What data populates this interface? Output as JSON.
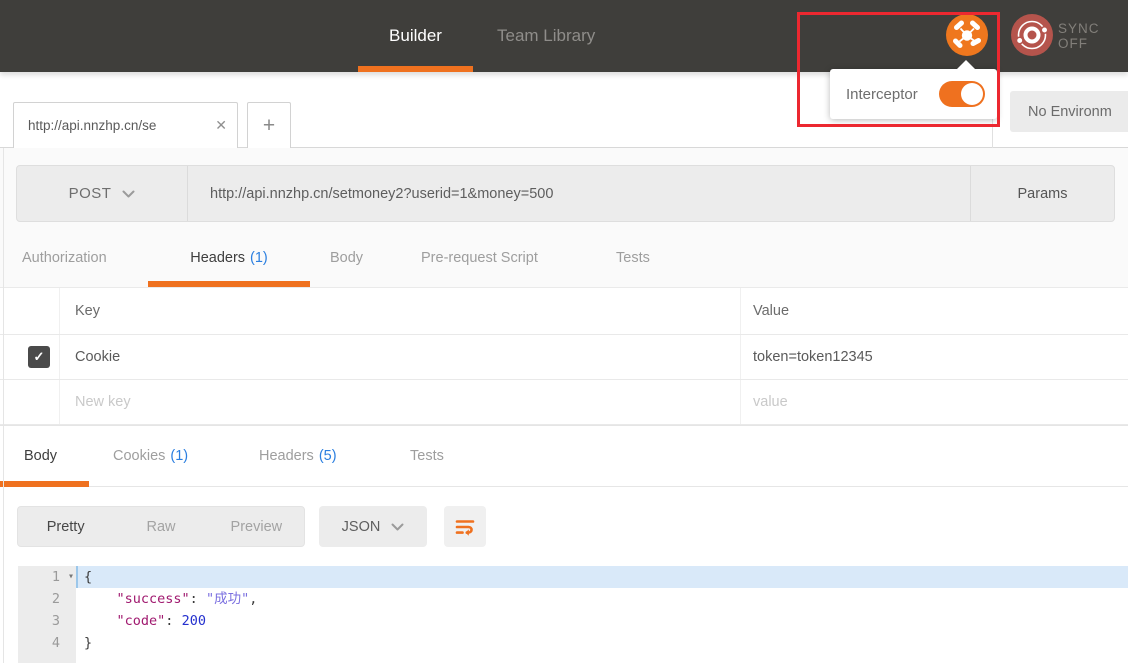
{
  "header": {
    "builder_label": "Builder",
    "team_library_label": "Team Library",
    "sync_status": "SYNC OFF"
  },
  "interceptor_popover": {
    "label": "Interceptor",
    "toggle_state": "on"
  },
  "environment": {
    "selector_label": "No Environm"
  },
  "tabs": {
    "open_tab_title": "http://api.nnzhp.cn/se"
  },
  "request": {
    "method": "POST",
    "url": "http://api.nnzhp.cn/setmoney2?userid=1&money=500",
    "params_label": "Params",
    "tabs": {
      "authorization": {
        "label": "Authorization"
      },
      "headers": {
        "label": "Headers",
        "count": "(1)"
      },
      "body": {
        "label": "Body"
      },
      "pre_request_script": {
        "label": "Pre-request Script"
      },
      "tests": {
        "label": "Tests"
      }
    },
    "headers_table": {
      "key_header": "Key",
      "value_header": "Value",
      "rows": [
        {
          "checked": true,
          "key": "Cookie",
          "value": "token=token12345"
        }
      ],
      "new_row": {
        "key_placeholder": "New key",
        "value_placeholder": "value"
      }
    }
  },
  "response": {
    "tabs": {
      "body": {
        "label": "Body"
      },
      "cookies": {
        "label": "Cookies",
        "count": "(1)"
      },
      "headers": {
        "label": "Headers",
        "count": "(5)"
      },
      "tests": {
        "label": "Tests"
      }
    },
    "view_modes": {
      "pretty": "Pretty",
      "raw": "Raw",
      "preview": "Preview",
      "active": "Pretty"
    },
    "language": "JSON",
    "editor": {
      "line_numbers": [
        "1",
        "2",
        "3",
        "4"
      ],
      "lines": [
        [
          [
            "p",
            "{"
          ]
        ],
        [
          [
            "p",
            "    "
          ],
          [
            "k",
            "\"success\""
          ],
          [
            "p",
            ": "
          ],
          [
            "s",
            "\"成功\""
          ],
          [
            "p",
            ","
          ]
        ],
        [
          [
            "p",
            "    "
          ],
          [
            "k",
            "\"code\""
          ],
          [
            "p",
            ": "
          ],
          [
            "n",
            "200"
          ]
        ],
        [
          [
            "p",
            "}"
          ]
        ]
      ]
    }
  },
  "icons": {
    "close": "✕",
    "plus": "+",
    "check": "✓",
    "fold": "▾"
  },
  "colors": {
    "accent_orange": "#EF711F",
    "annotation_red": "#EC2830",
    "count_blue": "#2B7FE0",
    "header_bg": "#3F3E3B",
    "sync_icon_bg": "#B5544C",
    "json_key": "#A0196F",
    "json_string": "#7B70E0",
    "json_number": "#2430CE",
    "active_line_bg": "#D9E9F9"
  }
}
